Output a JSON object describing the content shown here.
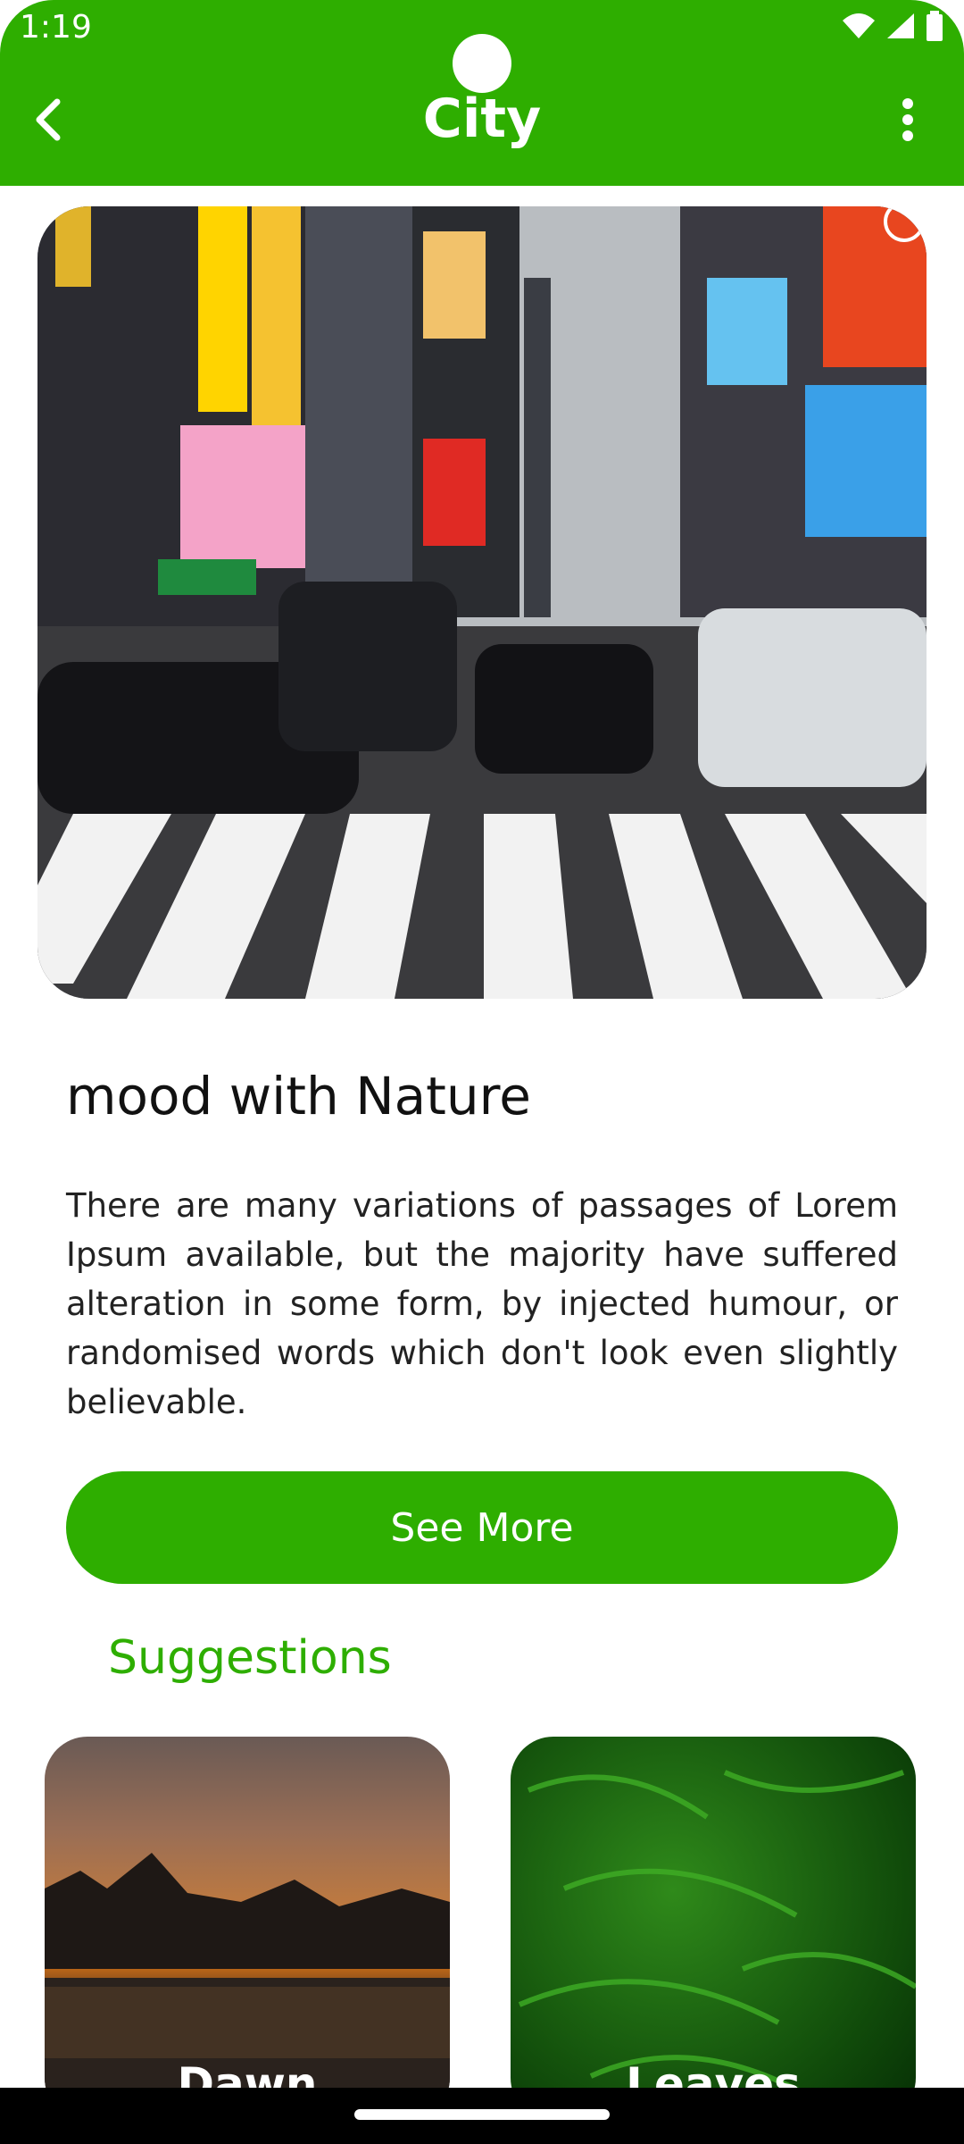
{
  "status_bar": {
    "time": "1:19"
  },
  "app_bar": {
    "title": "City",
    "back_icon": "arrow-back-icon",
    "more_icon": "more-vert-icon"
  },
  "hero": {
    "image_subject": "Times Square street with cars and crosswalk"
  },
  "article": {
    "headline": "mood with Nature",
    "body": "There are many variations of passages of Lorem Ipsum available, but the majority have suffered alteration in some form, by injected humour, or randomised words which don't look even slightly believable.",
    "cta_label": "See More"
  },
  "suggestions": {
    "title": "Suggestions",
    "items": [
      {
        "label": "Dawn"
      },
      {
        "label": "Leaves"
      }
    ]
  },
  "colors": {
    "accent": "#2eae00",
    "text": "#111111",
    "nav": "#000000"
  }
}
